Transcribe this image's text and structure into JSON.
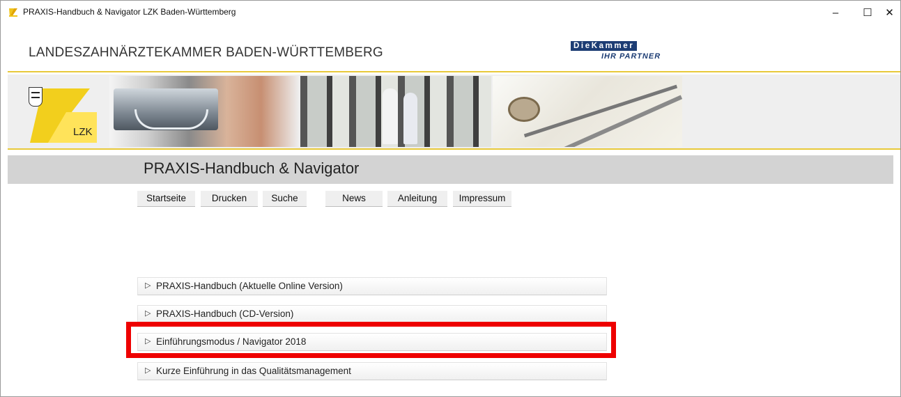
{
  "window": {
    "title": "PRAXIS-Handbuch & Navigator LZK Baden-Württemberg",
    "controls": [
      "–",
      "☐",
      "✕"
    ]
  },
  "header": {
    "org_name": "LANDESZAHNÄRZTEKAMMER BADEN-WÜRTTEMBERG",
    "partner_logo_top": "DieKammer",
    "partner_logo_tag": "IHR PARTNER",
    "lzk_logo_text": "LZK"
  },
  "page_title": "PRAXIS-Handbuch & Navigator",
  "nav": [
    "Startseite",
    "Drucken",
    "Suche",
    "News",
    "Anleitung",
    "Impressum"
  ],
  "sections": [
    {
      "arrow": "▷",
      "label": "PRAXIS-Handbuch (Aktuelle Online Version)"
    },
    {
      "arrow": "▷",
      "label": "PRAXIS-Handbuch (CD-Version)"
    },
    {
      "arrow": "▷",
      "label": "Einführungsmodus / Navigator 2018"
    },
    {
      "arrow": "▷",
      "label": "Kurze Einführung in das Qualitätsmanagement"
    }
  ],
  "colors": {
    "gold": "#e8c93a",
    "navy": "#1d3d74",
    "highlight": "#ee0000",
    "title_bar_bg": "#d3d3d3"
  }
}
